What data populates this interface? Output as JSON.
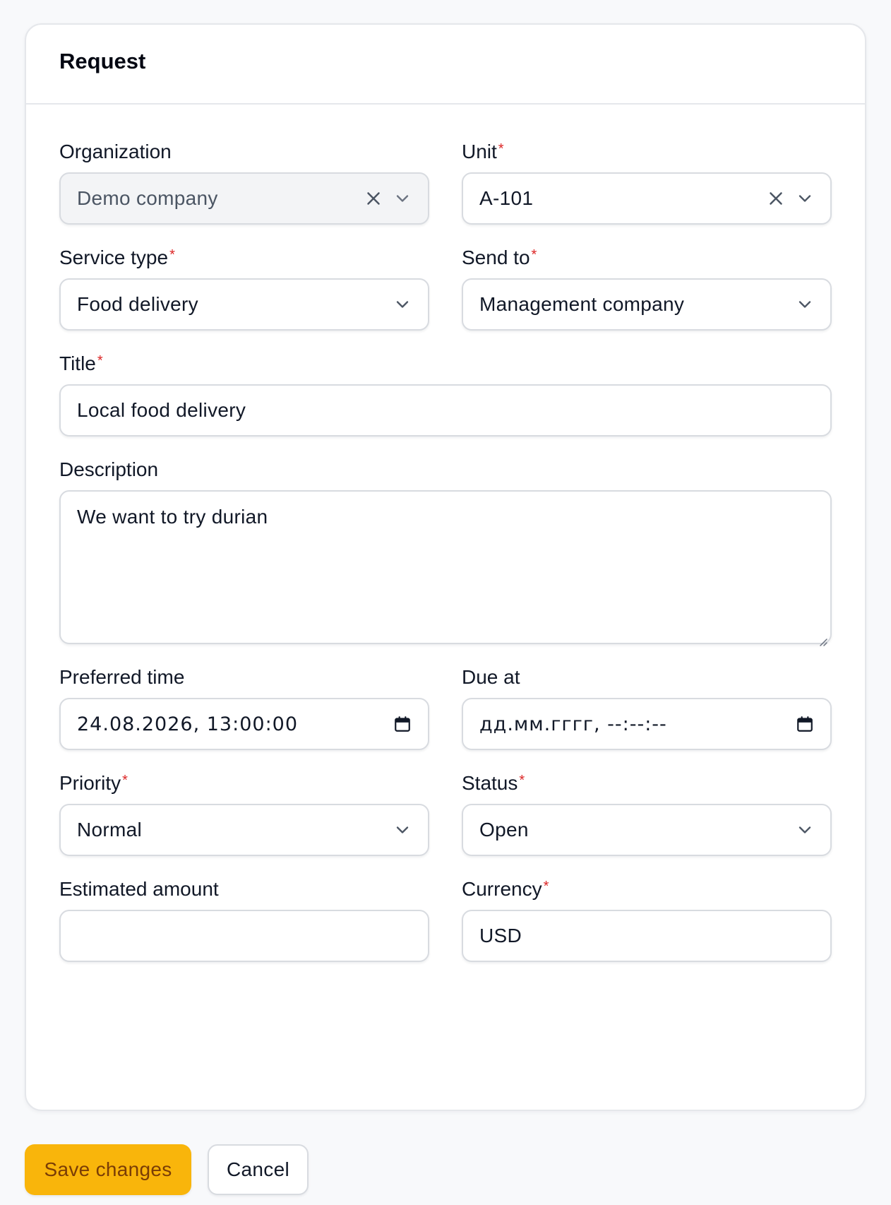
{
  "card": {
    "title": "Request"
  },
  "fields": {
    "organization": {
      "label": "Organization",
      "value": "Demo company",
      "required": false
    },
    "unit": {
      "label": "Unit",
      "value": "A-101",
      "required": true
    },
    "service_type": {
      "label": "Service type",
      "value": "Food delivery",
      "required": true
    },
    "send_to": {
      "label": "Send to",
      "value": "Management company",
      "required": true
    },
    "title": {
      "label": "Title",
      "value": "Local food delivery",
      "required": true
    },
    "description": {
      "label": "Description",
      "value": "We want to try durian",
      "required": false
    },
    "preferred_time": {
      "label": "Preferred time",
      "value": "24.08.2026, 13:00:00",
      "required": false
    },
    "due_at": {
      "label": "Due at",
      "value": "дд.мм.гггг, --:--:--",
      "required": false
    },
    "priority": {
      "label": "Priority",
      "value": "Normal",
      "required": true
    },
    "status": {
      "label": "Status",
      "value": "Open",
      "required": true
    },
    "estimated_amount": {
      "label": "Estimated amount",
      "value": "",
      "required": false
    },
    "currency": {
      "label": "Currency",
      "value": "USD",
      "required": true
    }
  },
  "required_marker": "*",
  "actions": {
    "save_label": "Save changes",
    "cancel_label": "Cancel"
  },
  "icons": {
    "clear": "close-icon",
    "dropdown": "chevron-down-icon",
    "calendar": "calendar-icon",
    "resize": "resize-handle-icon"
  },
  "colors": {
    "accent": "#f9b50b",
    "accent_text": "#7a3d06",
    "required": "#dc2626",
    "border": "#d8dbe0",
    "disabled_bg": "#f3f4f6"
  }
}
